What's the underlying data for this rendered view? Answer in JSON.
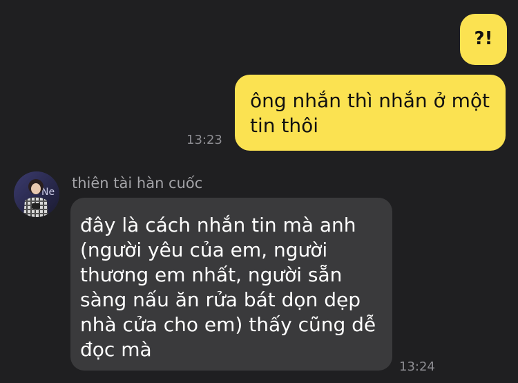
{
  "colors": {
    "background": "#1f1f21",
    "outgoing_bubble": "#fbe251",
    "incoming_bubble": "#3a3a3c",
    "timestamp": "#8e8e93"
  },
  "messages": [
    {
      "direction": "outgoing",
      "text": "?!"
    },
    {
      "direction": "outgoing",
      "lines": [
        "ông nhắn thì nhắn ở một",
        "tin thôi"
      ],
      "time": "13:23"
    },
    {
      "direction": "incoming",
      "sender": "thiên tài hàn cuốc",
      "lines": [
        "đây là cách nhắn tin mà anh",
        "(người yêu của em, người",
        "thương em nhất, người sẵn",
        "sàng nấu ăn rửa bát dọn dẹp",
        "nhà cửa cho em) thấy cũng dễ",
        "đọc mà"
      ],
      "time": "13:24"
    }
  ]
}
